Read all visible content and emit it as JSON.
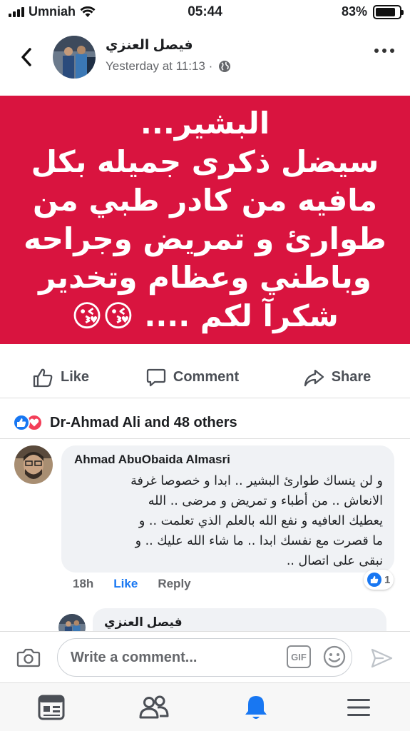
{
  "status_bar": {
    "carrier": "Umniah",
    "time": "05:44",
    "battery": "83%",
    "battery_level": 0.83
  },
  "post": {
    "author": "فيصل العنزي",
    "timestamp": "Yesterday at 11:13 ·",
    "privacy_icon": "globe-icon",
    "image_text_lines": [
      "البشير...",
      "سيضل ذكرى جميله  بكل",
      "مافيه من كادر طبي من",
      "طوارئ و تمريض وجراحه",
      "وباطني وعظام وتخدير",
      "شكرآ لكم .... 😘😘"
    ],
    "image_background": "#d9143f"
  },
  "actions": {
    "like": "Like",
    "comment": "Comment",
    "share": "Share"
  },
  "reactions": {
    "summary": "Dr-Ahmad Ali and 48 others",
    "icons": [
      "like-icon",
      "love-icon"
    ]
  },
  "comment": {
    "author": "Ahmad AbuObaida Almasri",
    "lines": [
      "و لن ينساك طوارئ البشير .. ابدا و خصوصا غرفة",
      "الانعاش .. من أطباء و تمريض و مرضى .. الله",
      "يعطيك العافيه و نفع الله بالعلم الذي تعلمت .. و",
      "ما قصرت مع نفسك ابدا .. ما شاء الله عليك .. و",
      "نبقى على اتصال .."
    ],
    "time": "18h",
    "like_label": "Like",
    "reply_label": "Reply",
    "reaction_count": "1"
  },
  "reply": {
    "author": "فيصل العنزي"
  },
  "composer": {
    "placeholder": "Write a comment...",
    "gif_label": "GIF"
  },
  "bottom_nav": [
    "news-feed-icon",
    "friends-icon",
    "notifications-icon",
    "menu-icon"
  ],
  "colors": {
    "accent": "#1877f2",
    "love": "#f33e58",
    "post_bg": "#d9143f"
  }
}
